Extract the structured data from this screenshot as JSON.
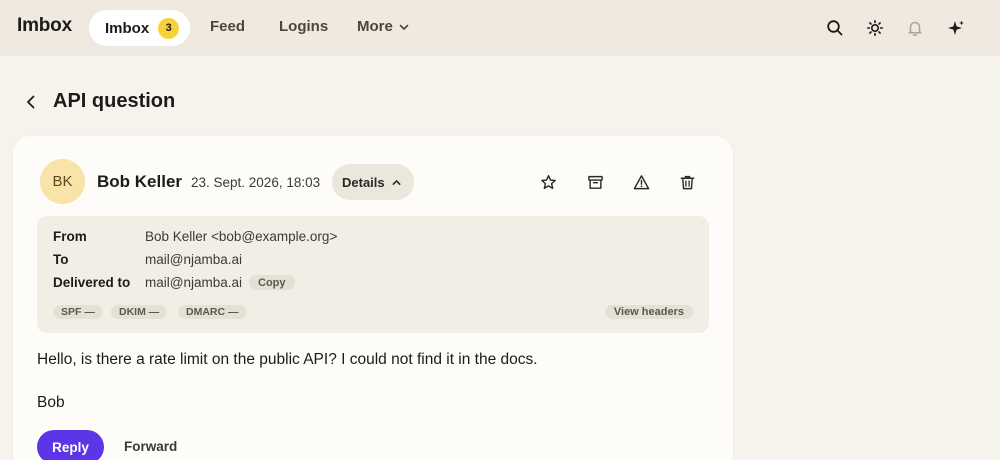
{
  "nav": {
    "brand": "Imbox",
    "active_tab": {
      "label": "Imbox",
      "badge": "3"
    },
    "tabs": [
      "Feed",
      "Logins",
      "More"
    ],
    "icons": [
      "search-icon",
      "sun-icon",
      "bell-icon",
      "sparkle-icon"
    ]
  },
  "page": {
    "title": "API question"
  },
  "email": {
    "sender_initials": "BK",
    "sender_name": "Bob Keller",
    "date": "23. Sept. 2026, 18:03",
    "details_label": "Details",
    "actions": [
      "star-icon",
      "archive-icon",
      "warning-icon",
      "trash-icon"
    ],
    "details": {
      "from_label": "From",
      "from_value": "Bob Keller <bob@example.org>",
      "to_label": "To",
      "to_value": "mail@njamba.ai",
      "delivered_label": "Delivered to",
      "delivered_value": "mail@njamba.ai",
      "copy_label": "Copy",
      "auth": [
        "SPF —",
        "DKIM —",
        "DMARC —"
      ],
      "view_headers": "View headers"
    },
    "body": [
      "Hello, is there a rate limit on the public API? I could not find it in the docs.",
      "Bob"
    ],
    "reply_label": "Reply",
    "forward_label": "Forward"
  },
  "colors": {
    "accent": "#5b35e6",
    "badge": "#f6d33c",
    "avatar": "#f8e3a8",
    "background": "#f5f3ec"
  }
}
